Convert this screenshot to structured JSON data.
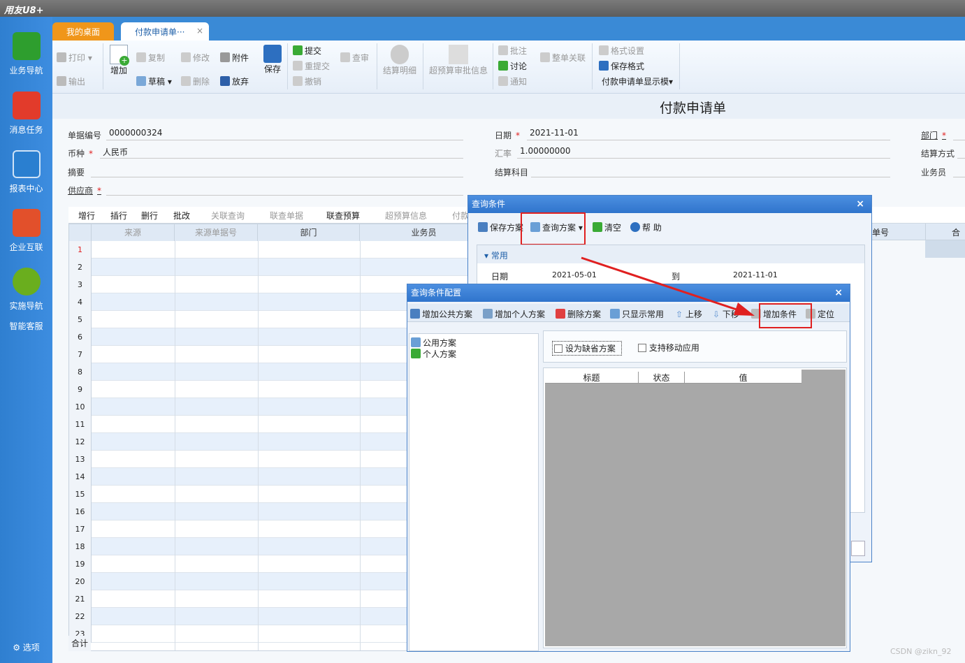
{
  "app": {
    "logo": "用友U8+"
  },
  "sidebar": {
    "items": [
      {
        "label": "业务导航",
        "icon": "business-nav-icon",
        "color": "#2e9e2e"
      },
      {
        "label": "消息任务",
        "icon": "message-icon",
        "color": "#e23b2b"
      },
      {
        "label": "报表中心",
        "icon": "report-icon",
        "color": "#2a7fd0"
      },
      {
        "label": "企业互联",
        "icon": "enterprise-icon",
        "color": "#e2502b"
      },
      {
        "label": "实施导航",
        "icon": "compass-icon",
        "color": "#6aae1e"
      }
    ],
    "extra_label": "智能客服",
    "options_label": "选项"
  },
  "tabs": [
    {
      "label": "我的桌面",
      "active": false
    },
    {
      "label": "付款申请单···",
      "active": true
    }
  ],
  "toolbar": {
    "print": "打印",
    "output": "输出",
    "add": "增加",
    "copy": "复制",
    "draft": "草稿",
    "modify": "修改",
    "delete": "删除",
    "attach": "附件",
    "discard": "放弃",
    "save": "保存",
    "submit": "提交",
    "resubmit": "重提交",
    "revoke": "撤销",
    "audit": "查审",
    "settle_detail": "结算明细",
    "over_budget": "超预算审批信息",
    "annotate": "批注",
    "discuss": "讨论",
    "notify": "通知",
    "link_all": "整单关联",
    "format_set": "格式设置",
    "save_format": "保存格式",
    "display_template": "付款申请单显示模▾"
  },
  "form": {
    "title": "付款申请单",
    "doc_no_label": "单据编号",
    "doc_no": "0000000324",
    "date_label": "日期",
    "date": "2021-11-01",
    "dept_label": "部门",
    "currency_label": "币种",
    "currency": "人民币",
    "rate_label": "汇率",
    "rate": "1.00000000",
    "settle_method_label": "结算方式",
    "summary_label": "摘要",
    "settle_subject_label": "结算科目",
    "salesman_label": "业务员",
    "supplier_label": "供应商"
  },
  "grid": {
    "toolbar": [
      "增行",
      "插行",
      "删行",
      "批改",
      "关联查询",
      "联查单据",
      "联查预算",
      "超预算信息",
      "付款"
    ],
    "toolbar_enabled": [
      true,
      true,
      true,
      true,
      false,
      false,
      true,
      false,
      false
    ],
    "columns": [
      "来源",
      "来源单据号",
      "部门",
      "业务员"
    ],
    "right_columns": [
      "单号",
      "合同"
    ],
    "rows": [
      "1",
      "2",
      "3",
      "4",
      "5",
      "6",
      "7",
      "8",
      "9",
      "10",
      "11",
      "12",
      "13",
      "14",
      "15",
      "16",
      "17",
      "18",
      "19",
      "20",
      "21",
      "22",
      "23"
    ],
    "total_label": "合计"
  },
  "query_dialog": {
    "title": "查询条件",
    "buttons": {
      "save_scheme": "保存方案",
      "query_scheme": "查询方案",
      "clear": "清空",
      "help": "帮 助"
    },
    "section": "常用",
    "date_label": "日期",
    "date_from": "2021-05-01",
    "to_label": "到",
    "date_to": "2021-11-01"
  },
  "config_dialog": {
    "title": "查询条件配置",
    "buttons": {
      "add_public": "增加公共方案",
      "add_personal": "增加个人方案",
      "delete_scheme": "删除方案",
      "show_common": "只显示常用",
      "move_up": "上移",
      "move_down": "下移",
      "add_condition": "增加条件",
      "locate": "定位"
    },
    "tree": {
      "public": "公用方案",
      "personal": "个人方案"
    },
    "set_default": "设为缺省方案",
    "support_mobile": "支持移动应用",
    "table_headers": [
      "标题",
      "状态",
      "值"
    ]
  },
  "watermark": "CSDN @zikn_92"
}
